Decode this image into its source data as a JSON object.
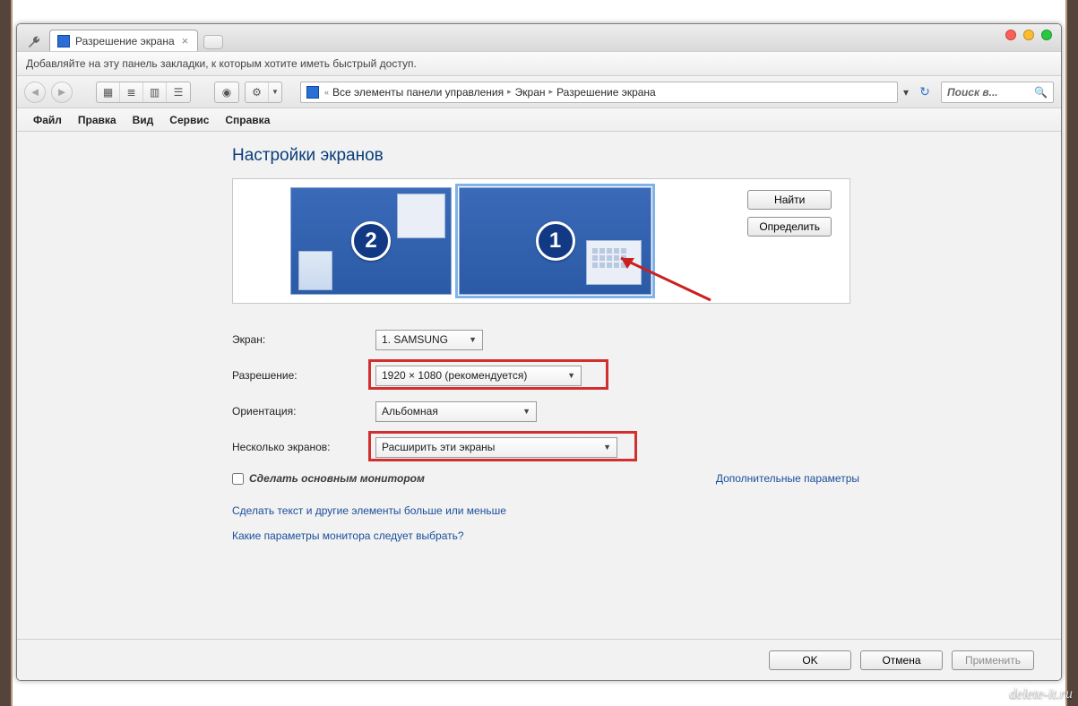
{
  "tab": {
    "title": "Разрешение экрана"
  },
  "bookmark_hint": "Добавляйте на эту панель закладки, к которым хотите иметь быстрый доступ.",
  "breadcrumb": {
    "root": "Все элементы панели управления",
    "mid": "Экран",
    "leaf": "Разрешение экрана"
  },
  "search": {
    "placeholder": "Поиск в..."
  },
  "menu": {
    "file": "Файл",
    "edit": "Правка",
    "view": "Вид",
    "service": "Сервис",
    "help": "Справка"
  },
  "page": {
    "heading": "Настройки экранов",
    "find": "Найти",
    "detect": "Определить",
    "monitor1_num": "1",
    "monitor2_num": "2",
    "labels": {
      "screen": "Экран:",
      "resolution": "Разрешение:",
      "orientation": "Ориентация:",
      "multi": "Несколько экранов:"
    },
    "values": {
      "screen": "1. SAMSUNG",
      "resolution": "1920 × 1080 (рекомендуется)",
      "orientation": "Альбомная",
      "multi": "Расширить эти экраны"
    },
    "make_primary": "Сделать основным монитором",
    "advanced": "Дополнительные параметры",
    "link1": "Сделать текст и другие элементы больше или меньше",
    "link2": "Какие параметры монитора следует выбрать?",
    "ok": "OK",
    "cancel": "Отмена",
    "apply": "Применить"
  },
  "watermark": "delete-it.ru"
}
